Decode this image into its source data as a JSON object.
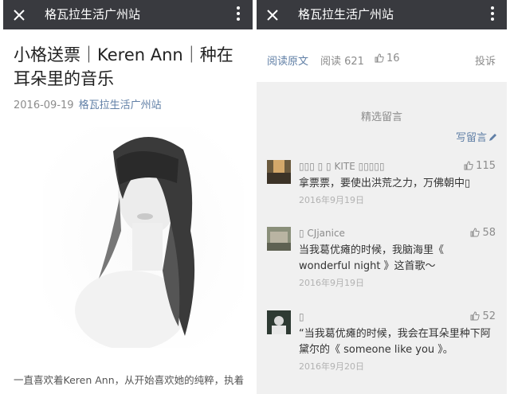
{
  "left": {
    "header": {
      "title": "格瓦拉生活广州站",
      "close_icon": "close-icon",
      "more_icon": "more-vertical-icon"
    },
    "article": {
      "title": "小格送票｜Keren Ann｜种在耳朵里的音乐",
      "date": "2016-09-19",
      "account": "格瓦拉生活广州站",
      "body_preview": "一直喜欢着Keren Ann，从开始喜欢她的纯粹，执着"
    }
  },
  "right": {
    "header": {
      "title": "格瓦拉生活广州站",
      "close_icon": "close-icon",
      "more_icon": "more-vertical-icon"
    },
    "stats": {
      "read_original": "阅读原文",
      "reads": "阅读 621",
      "likes": "16",
      "report": "投诉"
    },
    "comments_section": {
      "title": "精选留言",
      "write_label": "写留言"
    },
    "comments": [
      {
        "nickname": "▯▯▯ ▯ ▯ KITE ▯▯▯▯▯",
        "likes": "115",
        "text": "拿票票，要使出洪荒之力，万佛朝中▯",
        "date": "2016年9月19日"
      },
      {
        "nickname": "▯ CJjanice",
        "likes": "58",
        "text": "当我葛优瘫的时候，我脑海里《 wonderful night 》这首歌～",
        "date": "2016年9月19日"
      },
      {
        "nickname": "▯",
        "likes": "52",
        "text": "“当我葛优瘫的时候，我会在耳朵里种下阿黛尔的《 someone like you 》。",
        "date": "2016年9月20日"
      }
    ],
    "colors": {
      "accent": "#607fa6",
      "header_bg": "#393a3f"
    }
  }
}
